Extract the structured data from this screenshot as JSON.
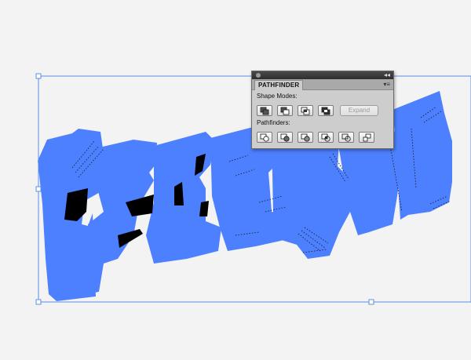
{
  "panel": {
    "tab_label": "PATHFINDER",
    "collapse_glyph": "◂◂",
    "menu_glyph": "▾≡",
    "shape_modes_label": "Shape Modes:",
    "pathfinders_label": "Pathfinders:",
    "expand_label": "Expand",
    "shape_mode_buttons": [
      "unite-icon",
      "minus-front-icon",
      "intersect-icon",
      "exclude-icon"
    ],
    "pathfinder_buttons": [
      "divide-icon",
      "trim-icon",
      "merge-icon",
      "crop-icon",
      "outline-icon",
      "minus-back-icon"
    ]
  },
  "colors": {
    "canvas_bg": "#f3f3f4",
    "artwork_fill": "#4d80ff",
    "selection": "#5b8ee6",
    "panel_bg": "#cdcdcd"
  }
}
